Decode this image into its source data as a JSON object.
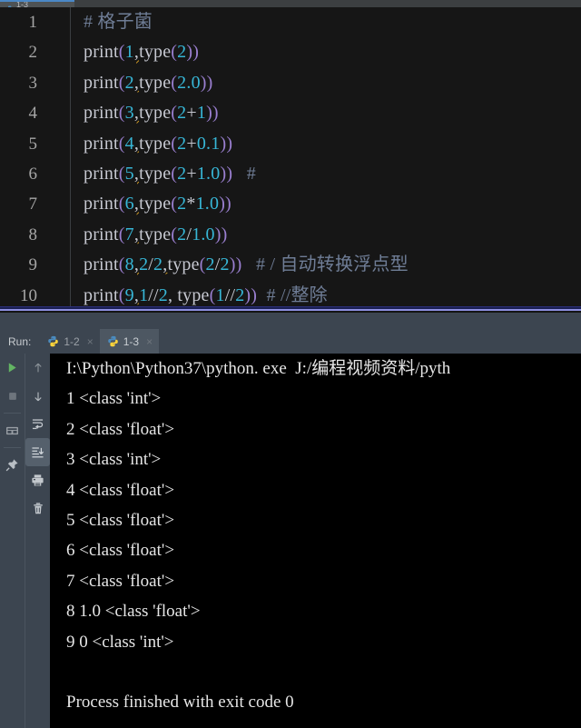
{
  "top_tab_strip": {
    "partial_tab": {
      "label": "1-3",
      "icon": "python-file-icon"
    }
  },
  "editor": {
    "language": "python",
    "line_numbers": [
      "1",
      "2",
      "3",
      "4",
      "5",
      "6",
      "7",
      "8",
      "9",
      "10"
    ],
    "lines": [
      {
        "n": "1",
        "tokens": [
          {
            "t": "comment",
            "v": "# 格子菌"
          }
        ]
      },
      {
        "n": "2",
        "tokens": [
          {
            "t": "fn",
            "v": "print"
          },
          {
            "t": "paren",
            "v": "("
          },
          {
            "t": "num",
            "v": "1"
          },
          {
            "t": "err",
            "v": ","
          },
          {
            "t": "fn",
            "v": "type"
          },
          {
            "t": "paren",
            "v": "("
          },
          {
            "t": "num",
            "v": "2"
          },
          {
            "t": "paren",
            "v": "))"
          }
        ]
      },
      {
        "n": "3",
        "tokens": [
          {
            "t": "fn",
            "v": "print"
          },
          {
            "t": "paren",
            "v": "("
          },
          {
            "t": "num",
            "v": "2"
          },
          {
            "t": "err",
            "v": ","
          },
          {
            "t": "fn",
            "v": "type"
          },
          {
            "t": "paren",
            "v": "("
          },
          {
            "t": "num",
            "v": "2.0"
          },
          {
            "t": "paren",
            "v": "))"
          }
        ]
      },
      {
        "n": "4",
        "tokens": [
          {
            "t": "fn",
            "v": "print"
          },
          {
            "t": "paren",
            "v": "("
          },
          {
            "t": "num",
            "v": "3"
          },
          {
            "t": "err",
            "v": ","
          },
          {
            "t": "fn",
            "v": "type"
          },
          {
            "t": "paren",
            "v": "("
          },
          {
            "t": "num",
            "v": "2"
          },
          {
            "t": "op",
            "v": "+"
          },
          {
            "t": "num",
            "v": "1"
          },
          {
            "t": "paren",
            "v": "))"
          }
        ]
      },
      {
        "n": "5",
        "tokens": [
          {
            "t": "fn",
            "v": "print"
          },
          {
            "t": "paren",
            "v": "("
          },
          {
            "t": "num",
            "v": "4"
          },
          {
            "t": "err",
            "v": ","
          },
          {
            "t": "fn",
            "v": "type"
          },
          {
            "t": "paren",
            "v": "("
          },
          {
            "t": "num",
            "v": "2"
          },
          {
            "t": "op",
            "v": "+"
          },
          {
            "t": "num",
            "v": "0.1"
          },
          {
            "t": "paren",
            "v": "))"
          }
        ]
      },
      {
        "n": "6",
        "tokens": [
          {
            "t": "fn",
            "v": "print"
          },
          {
            "t": "paren",
            "v": "("
          },
          {
            "t": "num",
            "v": "5"
          },
          {
            "t": "err",
            "v": ","
          },
          {
            "t": "fn",
            "v": "type"
          },
          {
            "t": "paren",
            "v": "("
          },
          {
            "t": "num",
            "v": "2"
          },
          {
            "t": "op",
            "v": "+"
          },
          {
            "t": "num",
            "v": "1.0"
          },
          {
            "t": "paren",
            "v": "))"
          },
          {
            "t": "comment",
            "v": "   #"
          }
        ]
      },
      {
        "n": "7",
        "tokens": [
          {
            "t": "fn",
            "v": "print"
          },
          {
            "t": "paren",
            "v": "("
          },
          {
            "t": "num",
            "v": "6"
          },
          {
            "t": "err",
            "v": ","
          },
          {
            "t": "fn",
            "v": "type"
          },
          {
            "t": "paren",
            "v": "("
          },
          {
            "t": "num",
            "v": "2"
          },
          {
            "t": "op",
            "v": "*"
          },
          {
            "t": "num",
            "v": "1.0"
          },
          {
            "t": "paren",
            "v": "))"
          }
        ]
      },
      {
        "n": "8",
        "tokens": [
          {
            "t": "fn",
            "v": "print"
          },
          {
            "t": "paren",
            "v": "("
          },
          {
            "t": "num",
            "v": "7"
          },
          {
            "t": "err",
            "v": ","
          },
          {
            "t": "fn",
            "v": "type"
          },
          {
            "t": "paren",
            "v": "("
          },
          {
            "t": "num",
            "v": "2"
          },
          {
            "t": "op",
            "v": "/"
          },
          {
            "t": "num",
            "v": "1.0"
          },
          {
            "t": "paren",
            "v": "))"
          }
        ]
      },
      {
        "n": "9",
        "tokens": [
          {
            "t": "fn",
            "v": "print"
          },
          {
            "t": "paren",
            "v": "("
          },
          {
            "t": "num",
            "v": "8"
          },
          {
            "t": "err",
            "v": ","
          },
          {
            "t": "num",
            "v": "2"
          },
          {
            "t": "op",
            "v": "/"
          },
          {
            "t": "num",
            "v": "2"
          },
          {
            "t": "err",
            "v": ","
          },
          {
            "t": "fn",
            "v": "type"
          },
          {
            "t": "paren",
            "v": "("
          },
          {
            "t": "num",
            "v": "2"
          },
          {
            "t": "op",
            "v": "/"
          },
          {
            "t": "num",
            "v": "2"
          },
          {
            "t": "paren",
            "v": "))"
          },
          {
            "t": "comment",
            "v": "   # / 自动转换浮点型"
          }
        ]
      },
      {
        "n": "10",
        "tokens": [
          {
            "t": "fn",
            "v": "print"
          },
          {
            "t": "paren",
            "v": "("
          },
          {
            "t": "num",
            "v": "9"
          },
          {
            "t": "err",
            "v": ","
          },
          {
            "t": "num",
            "v": "1"
          },
          {
            "t": "op",
            "v": "//"
          },
          {
            "t": "num",
            "v": "2"
          },
          {
            "t": "op",
            "v": ", "
          },
          {
            "t": "fn",
            "v": "type"
          },
          {
            "t": "paren",
            "v": "("
          },
          {
            "t": "num",
            "v": "1"
          },
          {
            "t": "op",
            "v": "//"
          },
          {
            "t": "num",
            "v": "2"
          },
          {
            "t": "paren",
            "v": "))"
          },
          {
            "t": "comment",
            "v": "  # //整除"
          }
        ]
      }
    ]
  },
  "run_panel": {
    "label": "Run:",
    "tabs": [
      {
        "label": "1-2",
        "icon": "python-icon",
        "close": "×",
        "active": false
      },
      {
        "label": "1-3",
        "icon": "python-icon",
        "close": "×",
        "active": true
      }
    ],
    "toolbar_left": [
      {
        "name": "rerun-button",
        "icon": "green-play-icon"
      },
      {
        "name": "stop-button",
        "icon": "stop-square-icon"
      },
      {
        "name": "restore-layout-button",
        "icon": "layout-icon"
      },
      {
        "name": "pin-tab-button",
        "icon": "pin-icon"
      }
    ],
    "toolbar_right": [
      {
        "name": "up-the-stack-trace-button",
        "icon": "arrow-up-icon"
      },
      {
        "name": "down-the-stack-trace-button",
        "icon": "arrow-down-icon"
      },
      {
        "name": "soft-wrap-button",
        "icon": "soft-wrap-icon"
      },
      {
        "name": "scroll-to-end-button",
        "icon": "scroll-to-end-icon",
        "selected": true
      },
      {
        "name": "print-button",
        "icon": "printer-icon"
      },
      {
        "name": "clear-all-button",
        "icon": "trash-icon"
      }
    ],
    "console_lines": [
      "I:\\Python\\Python37\\python. exe  J:/编程视频资料/pyth",
      "1 <class 'int'>",
      "2 <class 'float'>",
      "3 <class 'int'>",
      "4 <class 'float'>",
      "5 <class 'float'>",
      "6 <class 'float'>",
      "7 <class 'float'>",
      "8 1.0 <class 'float'>",
      "9 0 <class 'int'>",
      "",
      "Process finished with exit code 0"
    ]
  },
  "colors": {
    "editor_bg": "#161616",
    "console_bg": "#000000",
    "panel_bg": "#3c4550",
    "accent_divider": "#8d8fe0",
    "number_token": "#37b6d6",
    "paren_token": "#9a7fd0",
    "comment_token": "#6f7d96",
    "error_squiggle": "#d19a24",
    "run_play": "#63b463"
  }
}
